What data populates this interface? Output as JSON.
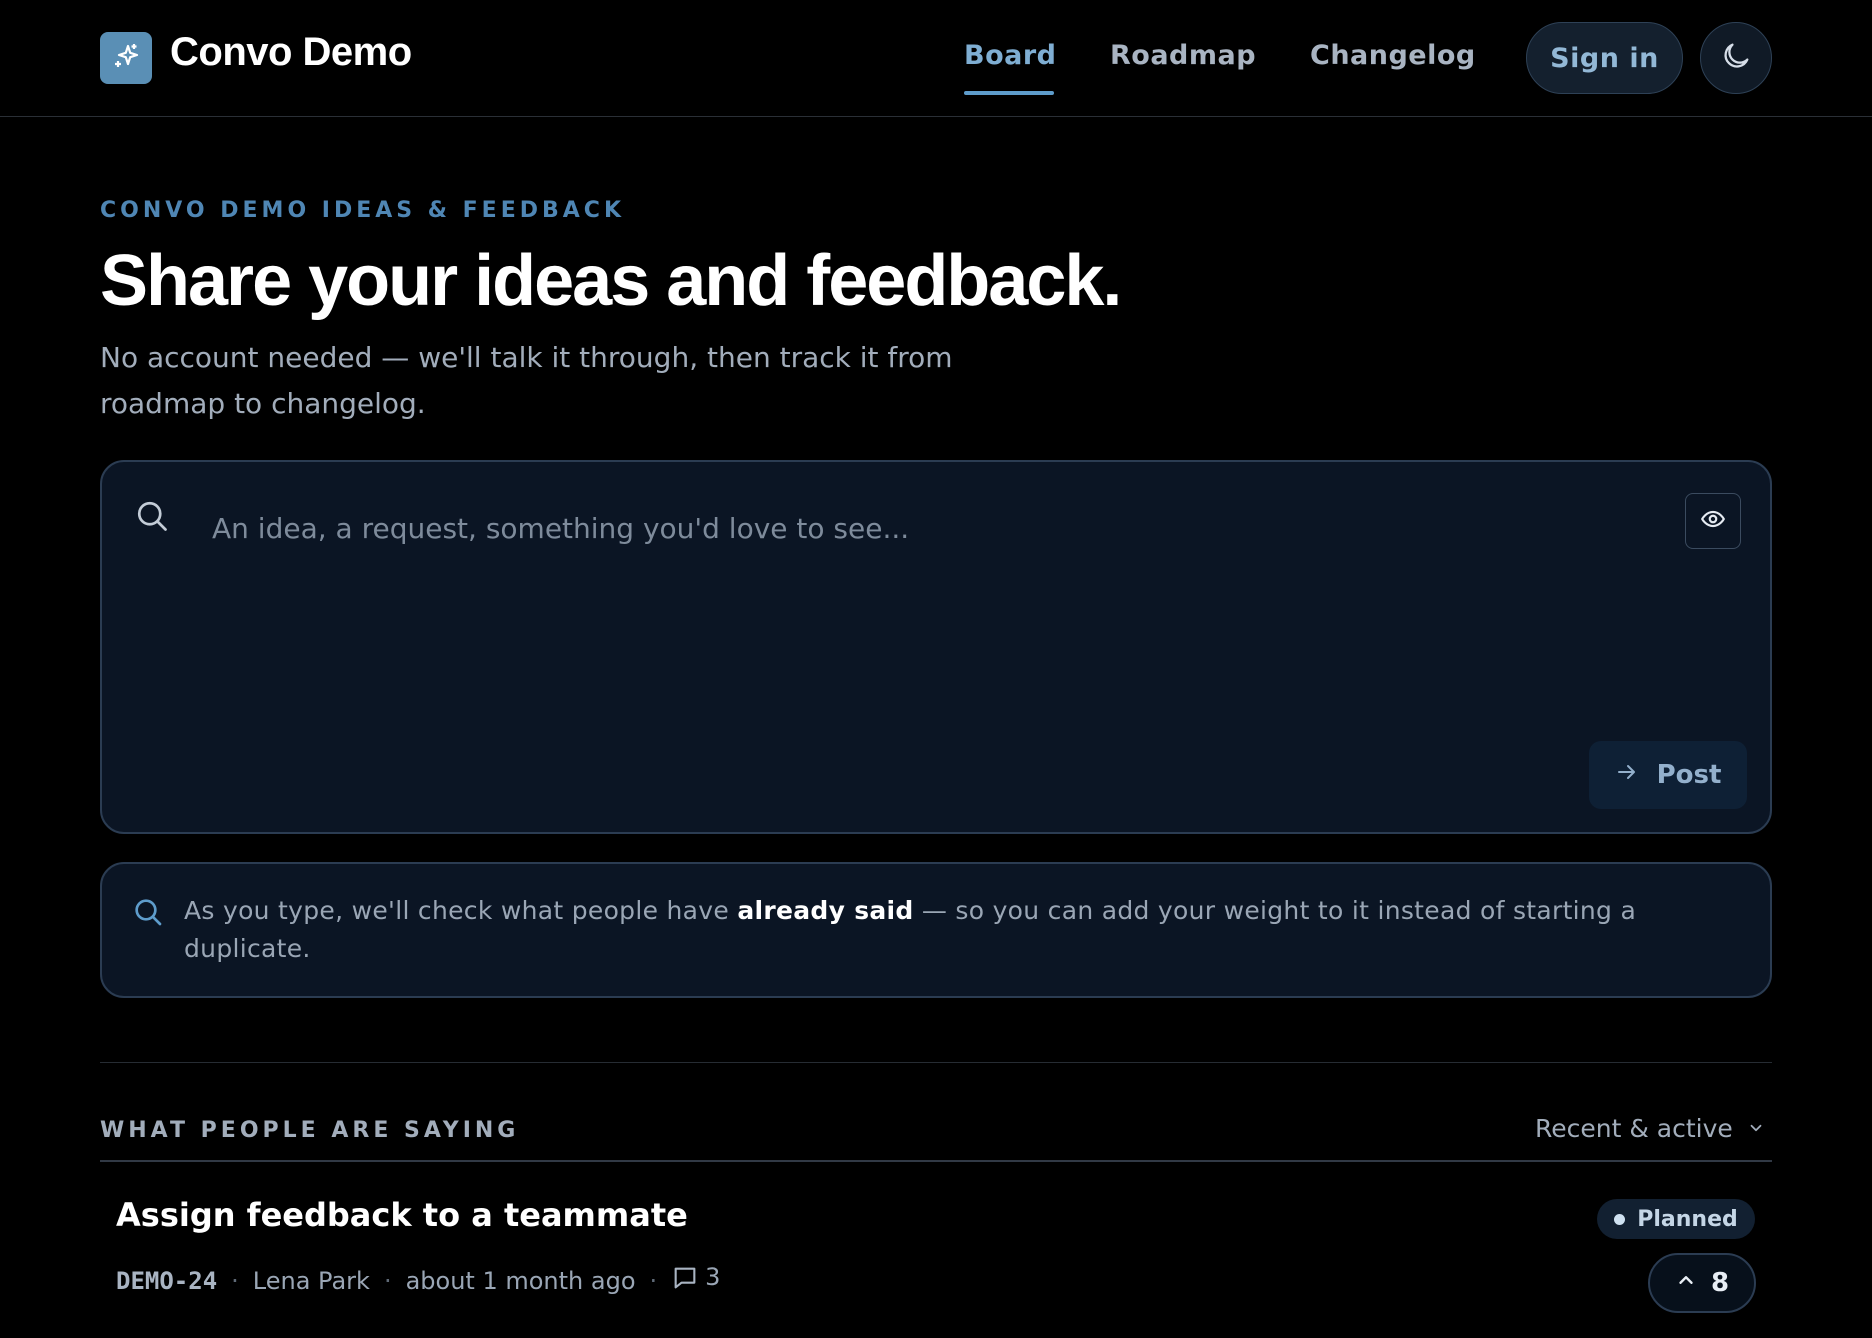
{
  "header": {
    "brand": "Convo Demo",
    "nav": [
      {
        "label": "Board",
        "active": true
      },
      {
        "label": "Roadmap",
        "active": false
      },
      {
        "label": "Changelog",
        "active": false
      }
    ],
    "sign_in": "Sign in",
    "icons": {
      "logo": "sparkles-icon",
      "theme": "moon-icon"
    }
  },
  "hero": {
    "eyebrow": "CONVO DEMO IDEAS & FEEDBACK",
    "title": "Share your ideas and feedback.",
    "subtitle": "No account needed — we'll talk it through, then track it from roadmap to changelog."
  },
  "composer": {
    "placeholder": "An idea, a request, something you'd love to see...",
    "post_label": "Post",
    "icons": {
      "search": "search-icon",
      "preview": "eye-icon",
      "post": "arrow-right-icon"
    }
  },
  "info": {
    "before": "As you type, we'll check what people have ",
    "bold": "already said",
    "after": " — so you can add your weight to it instead of starting a duplicate."
  },
  "feed": {
    "section_label": "WHAT PEOPLE ARE SAYING",
    "sort_label": "Recent & active",
    "posts": [
      {
        "title": "Assign feedback to a teammate",
        "id": "DEMO-24",
        "author": "Lena Park",
        "time": "about 1 month ago",
        "comments": "3",
        "status": "Planned",
        "votes": "8"
      }
    ]
  },
  "colors": {
    "background": "#000000",
    "accent": "#5e9ccb",
    "panel": "#0b1524",
    "logo": "#5a8fb5"
  }
}
